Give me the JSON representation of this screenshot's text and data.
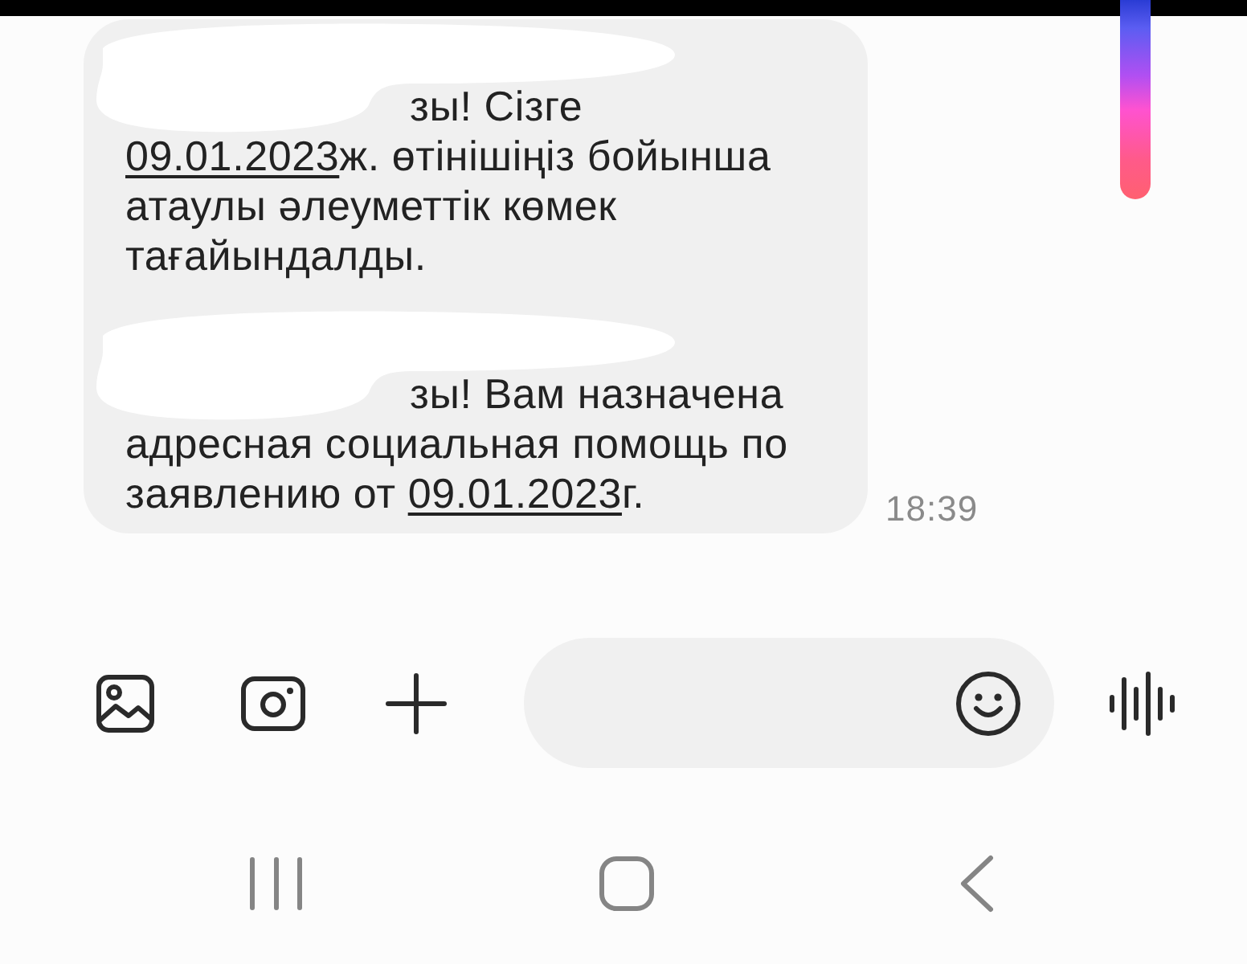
{
  "message": {
    "blocks": [
      {
        "lines": [
          {
            "kind": "hidden"
          },
          {
            "kind": "partly_hidden",
            "segments": [
              {
                "kind": "text",
                "text": "зы! Сізге"
              }
            ]
          },
          {
            "kind": "plain",
            "segments": [
              {
                "kind": "date",
                "text": "09.01.2023"
              },
              {
                "kind": "text",
                "text": "ж. өтінішіңіз бойынша"
              }
            ]
          },
          {
            "kind": "plain",
            "segments": [
              {
                "kind": "text",
                "text": "атаулы әлеуметтік көмек"
              }
            ]
          },
          {
            "kind": "plain",
            "segments": [
              {
                "kind": "text",
                "text": "тағайындалды."
              }
            ]
          }
        ]
      },
      {
        "lines": [
          {
            "kind": "hidden"
          },
          {
            "kind": "partly_hidden",
            "segments": [
              {
                "kind": "text",
                "text": "зы! Вам назначена"
              }
            ]
          },
          {
            "kind": "plain",
            "segments": [
              {
                "kind": "text",
                "text": "адресная социальная помощь по"
              }
            ]
          },
          {
            "kind": "plain",
            "segments": [
              {
                "kind": "text",
                "text": "заявлению от "
              },
              {
                "kind": "date",
                "text": "09.01.2023"
              },
              {
                "kind": "text",
                "text": "г."
              }
            ]
          }
        ]
      }
    ],
    "time": "18:39"
  }
}
